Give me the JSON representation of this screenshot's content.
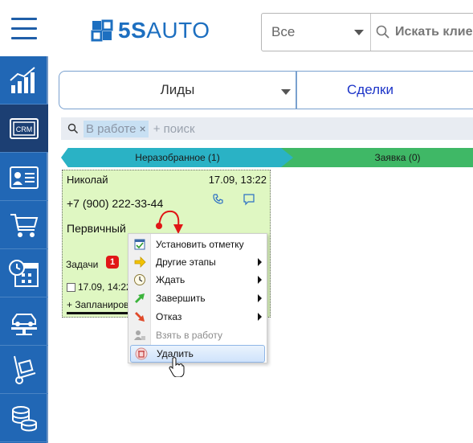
{
  "header": {
    "logo_prefix": "5S",
    "logo_suffix": "AUTO",
    "select_value": "Все",
    "search_placeholder": "Искать клие"
  },
  "sidebar": {
    "items": [
      {
        "icon": "analytics-chart-icon",
        "active": false
      },
      {
        "icon": "crm-icon",
        "label": "CRM",
        "active": true
      },
      {
        "icon": "contact-card-icon",
        "active": false
      },
      {
        "icon": "shopping-cart-icon",
        "active": false
      },
      {
        "icon": "calendar-clock-icon",
        "active": false
      },
      {
        "icon": "car-lift-icon",
        "active": false
      },
      {
        "icon": "hand-truck-icon",
        "active": false
      },
      {
        "icon": "coins-stack-icon",
        "active": false
      }
    ]
  },
  "tabs": {
    "leads": "Лиды",
    "deals": "Сделки"
  },
  "filter": {
    "chip": "В работе",
    "chip_remove": "×",
    "placeholder": "+ поиск"
  },
  "stages": [
    {
      "label": "Неразобранное (1)",
      "color": "#2ab2c5"
    },
    {
      "label": "Заявка (0)",
      "color": "#3fb866"
    }
  ],
  "card": {
    "name": "Николай",
    "date": "17.09, 13:22",
    "phone": "+7 (900) 222-33-44",
    "status": "Первичный",
    "tasks_label": "Задачи",
    "tasks_count": "1",
    "task_date": "17.09, 14:22",
    "planned": "+ Запланирова"
  },
  "context_menu": {
    "items": [
      {
        "label": "Установить отметку",
        "submenu": false,
        "disabled": false,
        "icon": "mark-icon"
      },
      {
        "label": "Другие этапы",
        "submenu": true,
        "disabled": false,
        "icon": "arrow-right-icon"
      },
      {
        "label": "Ждать",
        "submenu": true,
        "disabled": false,
        "icon": "clock-icon"
      },
      {
        "label": "Завершить",
        "submenu": true,
        "disabled": false,
        "icon": "complete-arrow-icon"
      },
      {
        "label": "Отказ",
        "submenu": true,
        "disabled": false,
        "icon": "reject-arrow-icon"
      },
      {
        "label": "Взять в работу",
        "submenu": false,
        "disabled": true,
        "icon": "take-work-icon"
      },
      {
        "label": "Удалить",
        "submenu": false,
        "disabled": false,
        "highlighted": true,
        "icon": "trash-icon"
      }
    ]
  },
  "colors": {
    "brand_blue": "#1d6fc0",
    "sidebar_bg": "#2167b5",
    "sidebar_active": "#1c3f73",
    "card_bg": "#dff7c2",
    "badge_red": "#e11717"
  }
}
